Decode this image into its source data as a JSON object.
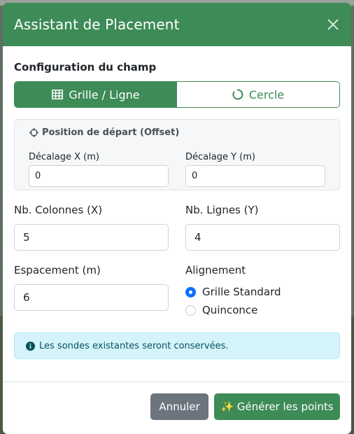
{
  "modal": {
    "title": "Assistant de Placement"
  },
  "config": {
    "section_title": "Configuration du champ",
    "modes": [
      {
        "label": "Grille / Ligne",
        "icon": "table-icon",
        "active": true
      },
      {
        "label": "Cercle",
        "icon": "circle-notch-icon",
        "active": false
      }
    ]
  },
  "offset": {
    "title": "Position de départ (Offset)",
    "icon": "crosshairs-icon",
    "x_label": "Décalage X (m)",
    "x_value": "0",
    "y_label": "Décalage Y (m)",
    "y_value": "0"
  },
  "grid": {
    "columns_label": "Nb. Colonnes (X)",
    "columns_value": "5",
    "rows_label": "Nb. Lignes (Y)",
    "rows_value": "4",
    "spacing_label": "Espacement (m)",
    "spacing_value": "6",
    "alignment_label": "Alignement",
    "alignment_options": [
      {
        "label": "Grille Standard",
        "checked": true
      },
      {
        "label": "Quinconce",
        "checked": false
      }
    ]
  },
  "info": {
    "icon": "info-circle-icon",
    "text": "Les sondes existantes seront conservées."
  },
  "footer": {
    "cancel_label": "Annuler",
    "generate_label": "✨ Générer les points"
  },
  "colors": {
    "primary_green": "#3d8b57",
    "info_bg": "#d4f3fa",
    "secondary": "#6c757d",
    "radio_blue": "#0d6efd"
  }
}
